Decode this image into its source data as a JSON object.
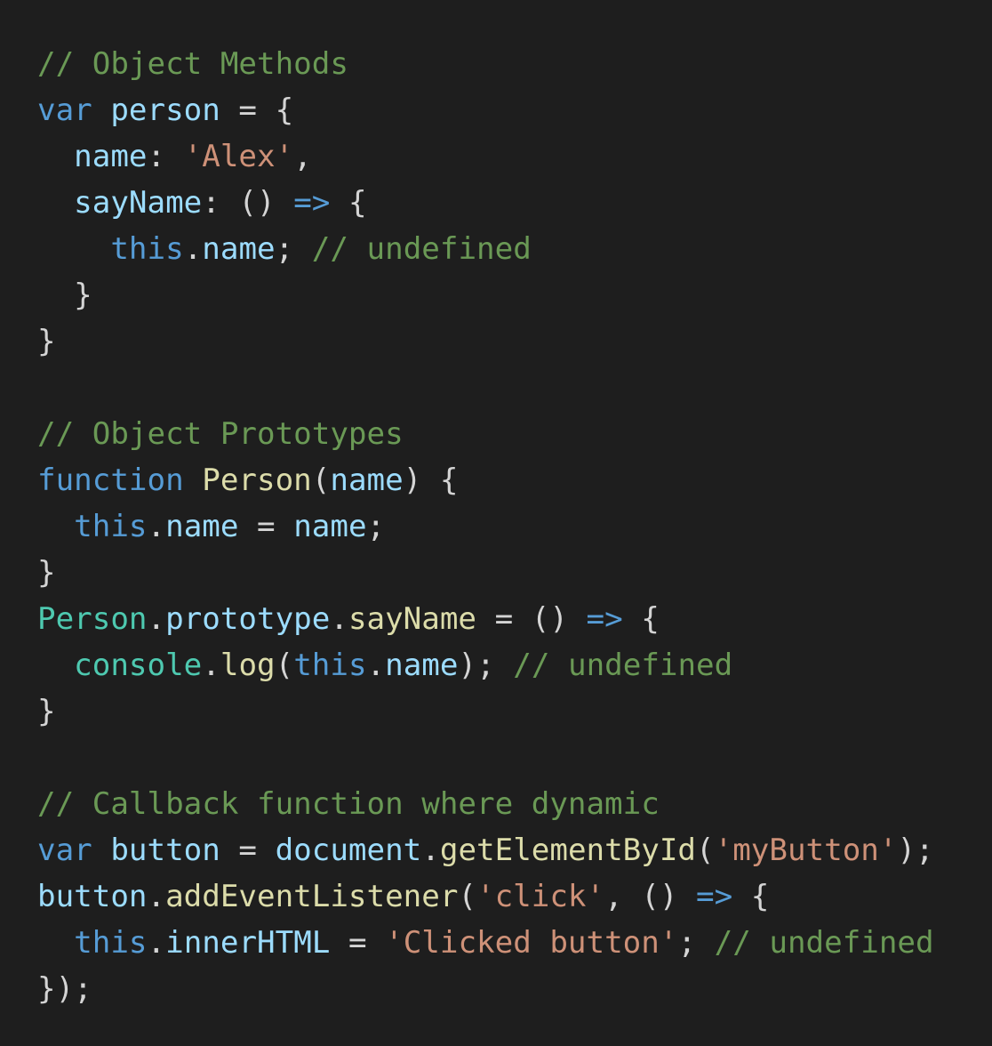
{
  "colors": {
    "background": "#1e1e1e",
    "default": "#d4d4d4",
    "comment": "#6a9955",
    "keyword": "#569cd6",
    "variable": "#9cdcfe",
    "string": "#ce9178",
    "function": "#dcdcaa",
    "type": "#4ec9b0"
  },
  "code_lines": [
    [
      [
        "comment",
        "// Object Methods"
      ]
    ],
    [
      [
        "keyword",
        "var"
      ],
      [
        "default",
        " "
      ],
      [
        "variable",
        "person"
      ],
      [
        "default",
        " = {"
      ]
    ],
    [
      [
        "default",
        "  "
      ],
      [
        "variable",
        "name"
      ],
      [
        "default",
        ": "
      ],
      [
        "string",
        "'Alex'"
      ],
      [
        "default",
        ","
      ]
    ],
    [
      [
        "default",
        "  "
      ],
      [
        "variable",
        "sayName"
      ],
      [
        "default",
        ": () "
      ],
      [
        "keyword",
        "=>"
      ],
      [
        "default",
        " {"
      ]
    ],
    [
      [
        "default",
        "    "
      ],
      [
        "keyword",
        "this"
      ],
      [
        "default",
        "."
      ],
      [
        "variable",
        "name"
      ],
      [
        "default",
        "; "
      ],
      [
        "comment",
        "// undefined"
      ]
    ],
    [
      [
        "default",
        "  }"
      ]
    ],
    [
      [
        "default",
        "}"
      ]
    ],
    [],
    [
      [
        "comment",
        "// Object Prototypes"
      ]
    ],
    [
      [
        "keyword",
        "function"
      ],
      [
        "default",
        " "
      ],
      [
        "function",
        "Person"
      ],
      [
        "default",
        "("
      ],
      [
        "variable",
        "name"
      ],
      [
        "default",
        ") {"
      ]
    ],
    [
      [
        "default",
        "  "
      ],
      [
        "keyword",
        "this"
      ],
      [
        "default",
        "."
      ],
      [
        "variable",
        "name"
      ],
      [
        "default",
        " = "
      ],
      [
        "variable",
        "name"
      ],
      [
        "default",
        ";"
      ]
    ],
    [
      [
        "default",
        "}"
      ]
    ],
    [
      [
        "type",
        "Person"
      ],
      [
        "default",
        "."
      ],
      [
        "variable",
        "prototype"
      ],
      [
        "default",
        "."
      ],
      [
        "function",
        "sayName"
      ],
      [
        "default",
        " = () "
      ],
      [
        "keyword",
        "=>"
      ],
      [
        "default",
        " {"
      ]
    ],
    [
      [
        "default",
        "  "
      ],
      [
        "type",
        "console"
      ],
      [
        "default",
        "."
      ],
      [
        "function",
        "log"
      ],
      [
        "default",
        "("
      ],
      [
        "keyword",
        "this"
      ],
      [
        "default",
        "."
      ],
      [
        "variable",
        "name"
      ],
      [
        "default",
        "); "
      ],
      [
        "comment",
        "// undefined"
      ]
    ],
    [
      [
        "default",
        "}"
      ]
    ],
    [],
    [
      [
        "comment",
        "// Callback function where dynamic"
      ]
    ],
    [
      [
        "keyword",
        "var"
      ],
      [
        "default",
        " "
      ],
      [
        "variable",
        "button"
      ],
      [
        "default",
        " = "
      ],
      [
        "variable",
        "document"
      ],
      [
        "default",
        "."
      ],
      [
        "function",
        "getElementById"
      ],
      [
        "default",
        "("
      ],
      [
        "string",
        "'myButton'"
      ],
      [
        "default",
        ");"
      ]
    ],
    [
      [
        "variable",
        "button"
      ],
      [
        "default",
        "."
      ],
      [
        "function",
        "addEventListener"
      ],
      [
        "default",
        "("
      ],
      [
        "string",
        "'click'"
      ],
      [
        "default",
        ", () "
      ],
      [
        "keyword",
        "=>"
      ],
      [
        "default",
        " {"
      ]
    ],
    [
      [
        "default",
        "  "
      ],
      [
        "keyword",
        "this"
      ],
      [
        "default",
        "."
      ],
      [
        "variable",
        "innerHTML"
      ],
      [
        "default",
        " = "
      ],
      [
        "string",
        "'Clicked button'"
      ],
      [
        "default",
        "; "
      ],
      [
        "comment",
        "// undefined"
      ]
    ],
    [
      [
        "default",
        "});"
      ]
    ]
  ]
}
